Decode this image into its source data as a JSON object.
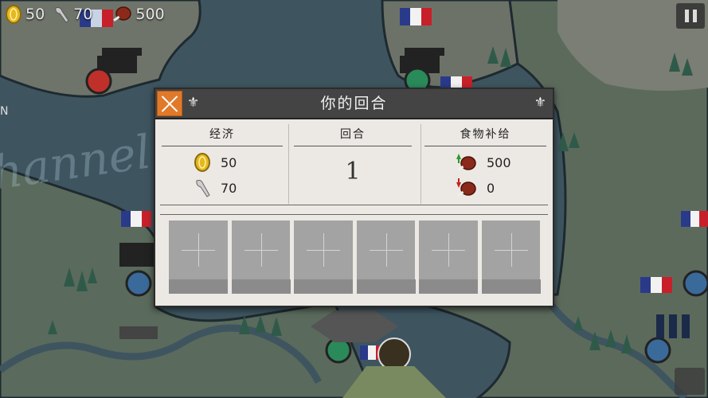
{
  "resources": {
    "gold": "50",
    "industry": "70",
    "food": "500"
  },
  "map": {
    "channel_text": "hannel",
    "edge_label": "N"
  },
  "dialog": {
    "title": "你的回合",
    "economy": {
      "header": "经济",
      "gold": "50",
      "industry": "70"
    },
    "turn": {
      "header": "回合",
      "value": "1"
    },
    "supply": {
      "header": "食物补给",
      "income": "500",
      "expense": "0"
    },
    "slot_count": 6
  },
  "colors": {
    "header_bg": "#444444",
    "close_button": "#e07a2a",
    "panel_bg": "#ece9e4",
    "slot_bg": "#a3a3a3",
    "water": "#3e5560",
    "land": "#6d7466"
  },
  "icons": [
    "gold-coin-icon",
    "wrench-icon",
    "meat-icon",
    "pause-icon",
    "close-icon",
    "fleur-icon",
    "arrow-up-icon",
    "arrow-down-icon"
  ]
}
